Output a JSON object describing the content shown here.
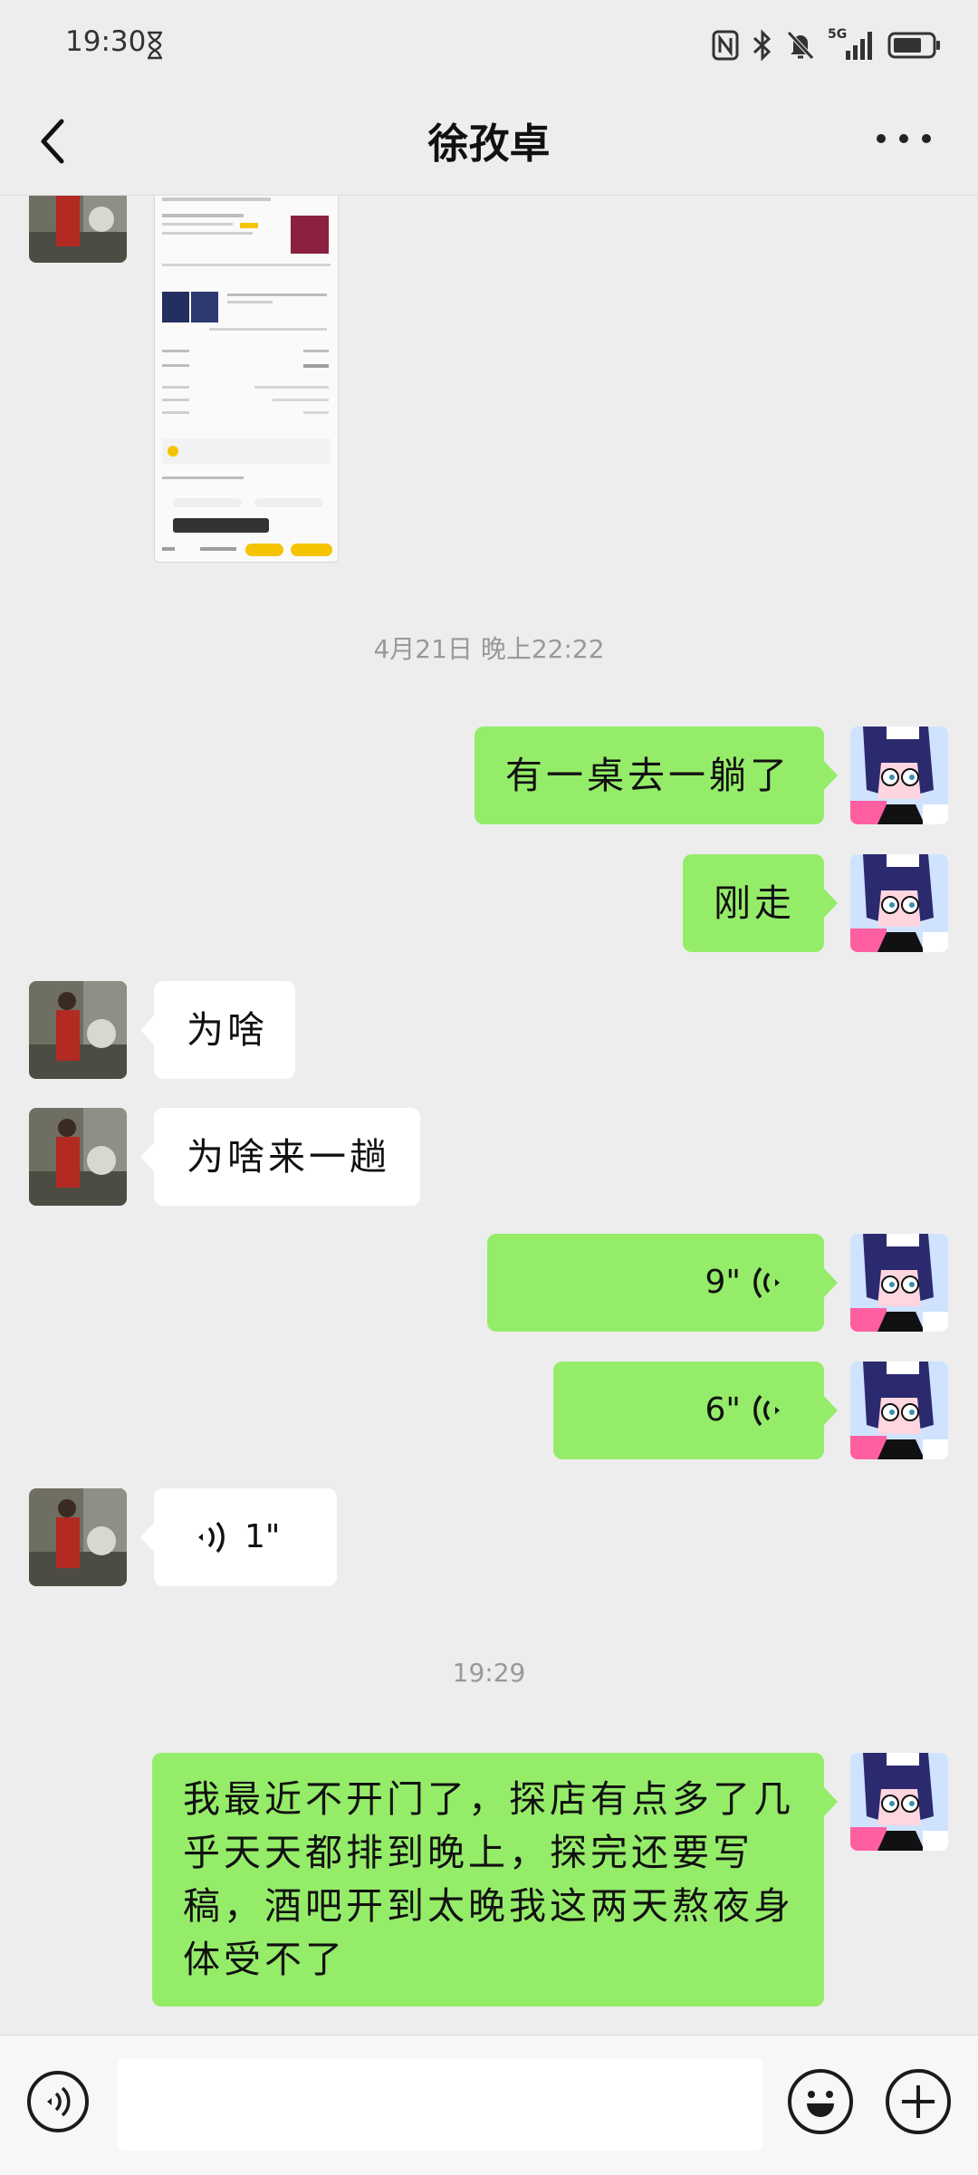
{
  "status_bar": {
    "time": "19:30",
    "network": "5G",
    "icons": [
      "hourglass-icon",
      "nfc-icon",
      "bluetooth-icon",
      "mute-bell-icon",
      "signal-icon",
      "battery-icon"
    ]
  },
  "header": {
    "title": "徐孜卓",
    "back_icon": "chevron-left-icon",
    "more_icon": "more-dots-icon"
  },
  "timestamps": {
    "first": "4月21日 晚上22:22",
    "second": "19:29"
  },
  "messages": {
    "m1": "有一桌去一躺了",
    "m2": "刚走",
    "m3": "为啥",
    "m4": "为啥来一趟",
    "m5_duration": "9\"",
    "m6_duration": "6\"",
    "m7_duration": "1\"",
    "m8": "我最近不开门了，探店有点多了几乎天天都排到晚上，探完还要写稿，酒吧开到太晚我这两天熬夜身体受不了"
  },
  "colors": {
    "my_bubble": "#95ec69",
    "their_bubble": "#ffffff",
    "background": "#ededed"
  },
  "input_bar": {
    "left_icon": "voice-input-icon",
    "right_icons": [
      "emoji-icon",
      "plus-icon"
    ]
  }
}
